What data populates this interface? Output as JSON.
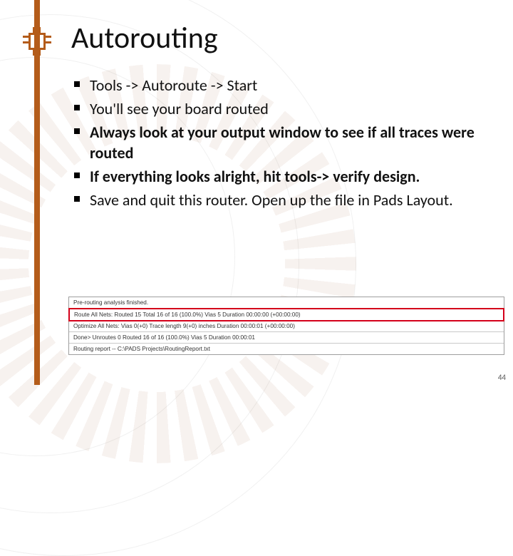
{
  "slide": {
    "title": "Autorouting",
    "page_number": "44"
  },
  "bullets": [
    "Tools -> Autoroute -> Start",
    "You'll see your board routed",
    "Always look at your output window to see if all traces were routed",
    "If everything looks alright, hit tools-> verify design.",
    "Save and quit this router. Open up the file in Pads Layout."
  ],
  "output": {
    "lines": [
      "Pre-routing analysis finished.",
      "Route All Nets: Routed 15  Total 16 of 16 (100.0%) Vias 5 Duration 00:00:00 (+00:00:00)",
      "Optimize All Nets: Vias 0(+0) Trace length 9(+0) inches Duration 00:00:01 (+00:00:00)",
      "Done> Unroutes 0  Routed 16 of 16 (100.0%) Vias 5 Duration 00:00:01",
      "Routing report -- C:\\PADS Projects\\RoutingReport.txt"
    ],
    "highlight_index": 1
  },
  "colors": {
    "accent": "#b45c1a",
    "highlight_border": "#d4001a"
  }
}
